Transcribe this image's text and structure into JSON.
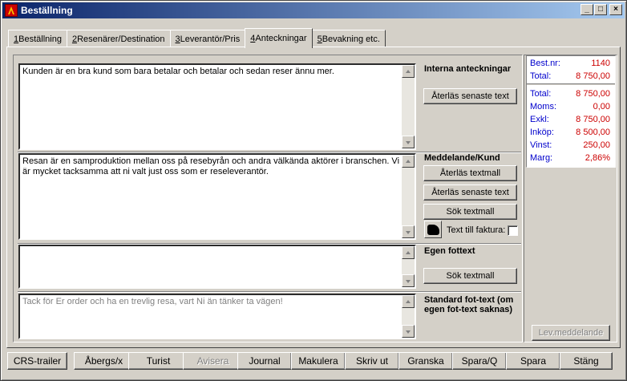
{
  "window": {
    "title": "Beställning"
  },
  "titlebar_buttons": {
    "minimize": "_",
    "maximize": "□",
    "close": "×"
  },
  "tabs": [
    {
      "num": "1",
      "label": " Beställning"
    },
    {
      "num": "2",
      "label": " Resenärer/Destination"
    },
    {
      "num": "3",
      "label": " Leverantör/Pris"
    },
    {
      "num": "4",
      "label": " Anteckningar"
    },
    {
      "num": "5",
      "label": " Bevakning etc."
    }
  ],
  "internal": {
    "text": "Kunden är en bra kund som bara betalar och betalar och sedan reser ännu mer.",
    "label": "Interna anteckningar",
    "restore_latest": "Återläs senaste text"
  },
  "message": {
    "text": "Resan är en samproduktion mellan oss på resebyrån och andra välkända aktörer i branschen. Vi är mycket tacksamma att ni valt just oss som er reseleverantör.",
    "label": "Meddelande/Kund",
    "restore_template": "Återläs textmall",
    "restore_latest": "Återläs senaste text",
    "search_template": "Sök textmall",
    "text_to_invoice": "Text till faktura:"
  },
  "own_footer": {
    "text": "",
    "label": "Egen fottext",
    "search_template": "Sök textmall"
  },
  "standard_footer": {
    "text": "Tack för Er order och ha en trevlig resa, vart Ni än tänker ta vägen!",
    "label": "Standard fot-text (om egen fot-text saknas)"
  },
  "summary": {
    "booking": {
      "label": "Best.nr:",
      "value": "1140"
    },
    "total_top": {
      "label": "Total:",
      "value": "8 750,00"
    },
    "total": {
      "label": "Total:",
      "value": "8 750,00"
    },
    "vat": {
      "label": "Moms:",
      "value": "0,00"
    },
    "excl": {
      "label": "Exkl:",
      "value": "8 750,00"
    },
    "purchase": {
      "label": "Inköp:",
      "value": "8 500,00"
    },
    "profit": {
      "label": "Vinst:",
      "value": "250,00"
    },
    "margin": {
      "label": "Marg:",
      "value": "2,86%"
    }
  },
  "supplier_message_button": "Lev.meddelande",
  "bottom_buttons": [
    {
      "label": "CRS-trailer",
      "ul": ""
    },
    {
      "label": "Åbergs/x",
      "ul": ""
    },
    {
      "label": "Turist",
      "ul": ""
    },
    {
      "label": "Avisera",
      "ul": ""
    },
    {
      "label": "Journal",
      "ul": ""
    },
    {
      "label": "Makulera",
      "ul": ""
    },
    {
      "label": "Skriv ut",
      "ul": ""
    },
    {
      "label": "Granska",
      "ul": ""
    },
    {
      "label": "Spara/Q",
      "ul": ""
    },
    {
      "label": "Spara",
      "ul": ""
    },
    {
      "label": "Stäng",
      "ul": ""
    }
  ]
}
